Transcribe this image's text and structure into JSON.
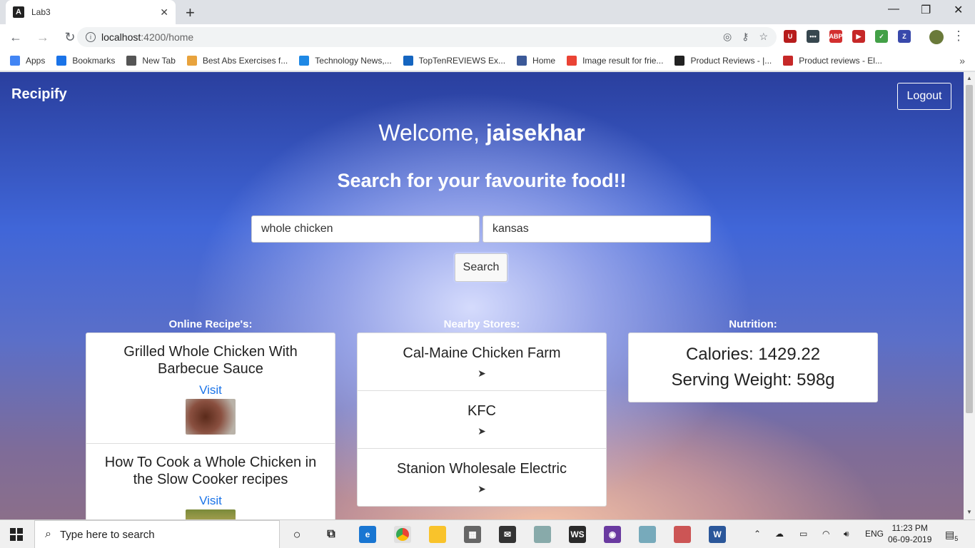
{
  "browser": {
    "tab_title": "Lab3",
    "url_host": "localhost",
    "url_rest": ":4200/home",
    "bookmarks": [
      {
        "label": "Apps",
        "color": "#4285f4"
      },
      {
        "label": "Bookmarks",
        "color": "#1a73e8"
      },
      {
        "label": "New Tab",
        "color": "#555555"
      },
      {
        "label": "Best Abs Exercises f...",
        "color": "#e8a33d"
      },
      {
        "label": "Technology News,...",
        "color": "#1e88e5"
      },
      {
        "label": "TopTenREVIEWS Ex...",
        "color": "#1565c0"
      },
      {
        "label": "Home",
        "color": "#3b5998"
      },
      {
        "label": "Image result for frie...",
        "color": "#ea4335"
      },
      {
        "label": "Product Reviews - |...",
        "color": "#222222"
      },
      {
        "label": "Product reviews - El...",
        "color": "#c62828"
      }
    ],
    "extensions": [
      {
        "label": "U",
        "color": "#b71c1c"
      },
      {
        "label": "•••",
        "color": "#37474f"
      },
      {
        "label": "ABP",
        "color": "#d32f2f"
      },
      {
        "label": "▶",
        "color": "#c62828"
      },
      {
        "label": "✓",
        "color": "#43a047"
      },
      {
        "label": "Z",
        "color": "#3949ab"
      }
    ]
  },
  "app": {
    "brand": "Recipify",
    "logout_label": "Logout",
    "welcome_prefix": "Welcome, ",
    "username": "jaisekhar",
    "subtitle": "Search for your favourite food!!",
    "food_input_value": "whole chicken",
    "location_input_value": "kansas",
    "search_label": "Search",
    "recipes_title": "Online Recipe's:",
    "stores_title": "Nearby Stores:",
    "nutrition_title": "Nutrition:",
    "recipes": [
      {
        "title": "Grilled Whole Chicken With Barbecue Sauce",
        "link": "Visit",
        "thumb_color": "#7a4a3a"
      },
      {
        "title": "How To Cook a Whole Chicken in the Slow Cooker recipes",
        "link": "Visit",
        "thumb_color": "#8a9a3a"
      }
    ],
    "stores": [
      {
        "name": "Cal-Maine Chicken Farm",
        "icon": "navigate-icon"
      },
      {
        "name": "KFC",
        "icon": "navigate-icon"
      },
      {
        "name": "Stanion Wholesale Electric",
        "icon": "navigate-icon"
      }
    ],
    "nutrition": {
      "calories": "Calories: 1429.22",
      "serving_weight": "Serving Weight: 598g"
    }
  },
  "taskbar": {
    "search_placeholder": "Type here to search",
    "language": "ENG",
    "time": "11:23 PM",
    "date": "06-09-2019",
    "notification_count": "5"
  }
}
